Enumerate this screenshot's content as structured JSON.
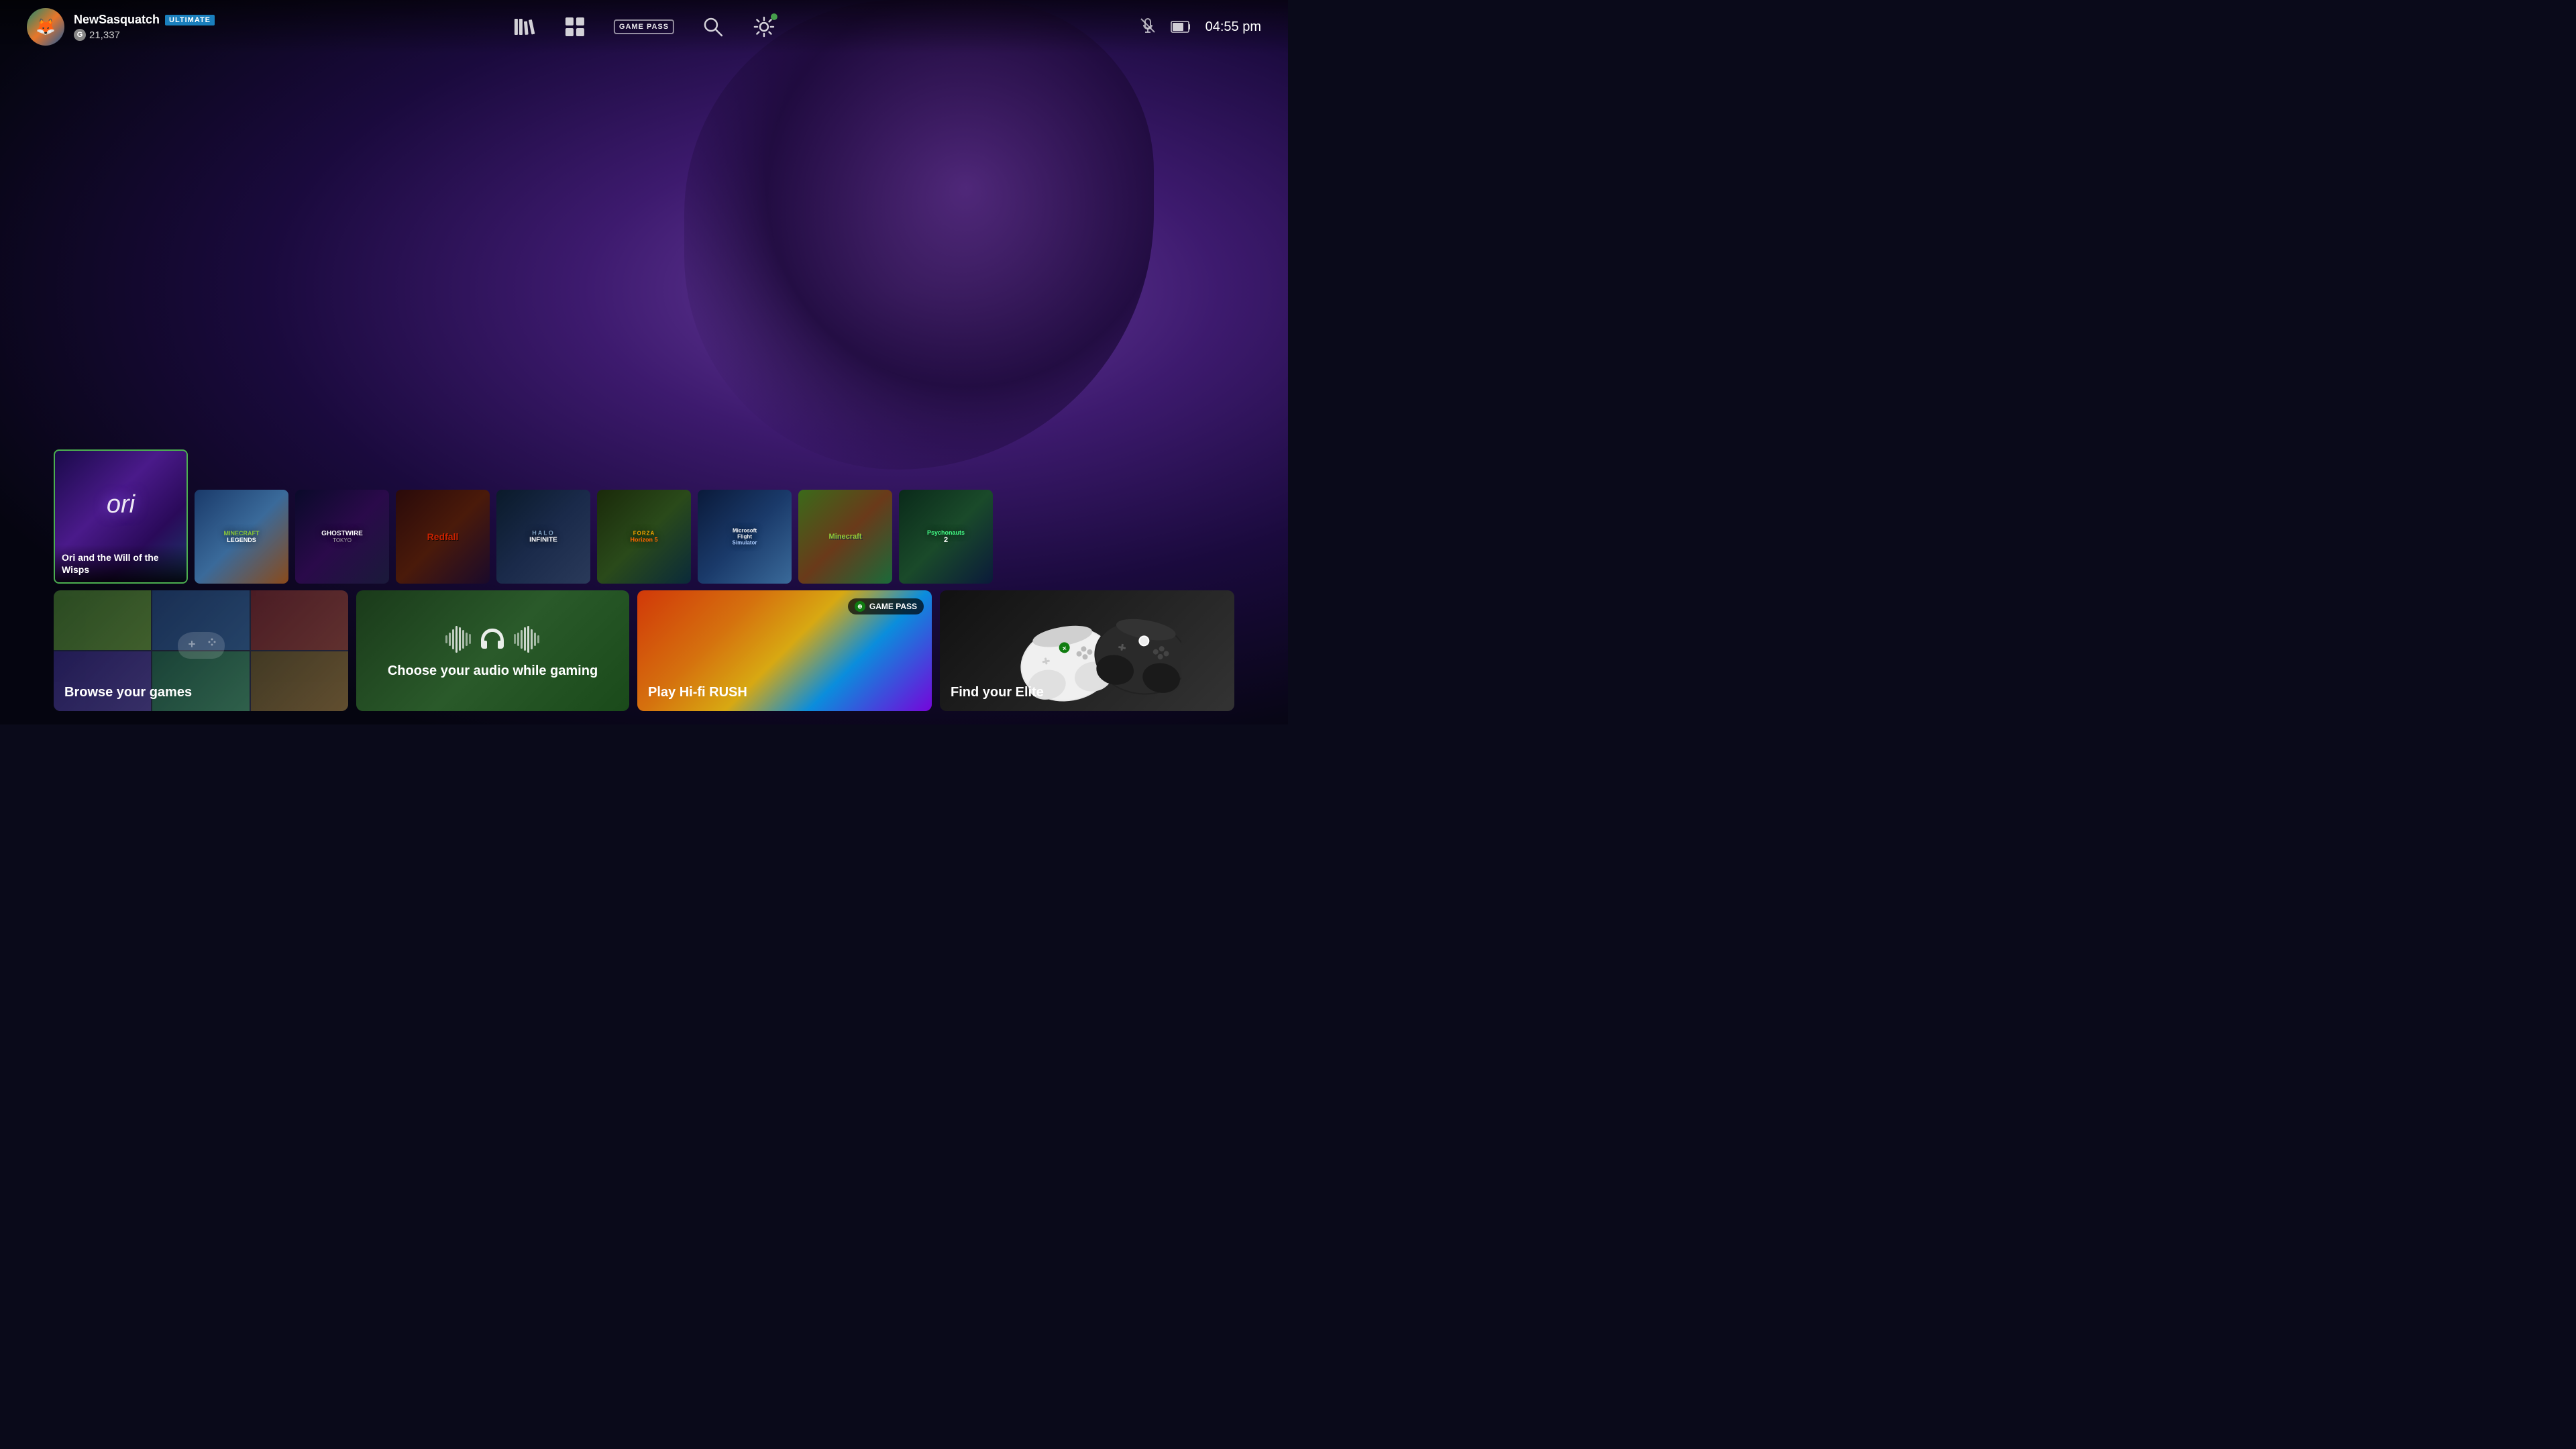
{
  "background": {
    "description": "Xbox dashboard with Ori and the Will of the Wisps wallpaper - dark purple forest with glowing bear"
  },
  "topbar": {
    "username": "NewSasquatch",
    "badge": "ULTIMATE",
    "gamerscore_label": "G",
    "gamerscore": "21,337",
    "nav": {
      "library_icon": "library",
      "grid_icon": "grid",
      "gamepass_label": "GAME PASS",
      "search_icon": "search",
      "settings_icon": "settings"
    },
    "status": {
      "mic_icon": "mic-slash",
      "battery_icon": "battery",
      "time": "04:55 pm"
    }
  },
  "games_row": [
    {
      "id": "ori",
      "title": "Ori and the Will of the Wisps",
      "featured": true,
      "art_class": "art-ori"
    },
    {
      "id": "minecraft-legends",
      "title": "Minecraft Legends",
      "featured": false,
      "art_class": "art-minecraft-legends"
    },
    {
      "id": "ghostwire",
      "title": "Ghostwire: Tokyo",
      "featured": false,
      "art_class": "art-ghostwire"
    },
    {
      "id": "redfall",
      "title": "Redfall",
      "featured": false,
      "art_class": "art-redfall"
    },
    {
      "id": "halo",
      "title": "Halo Infinite",
      "featured": false,
      "art_class": "art-halo"
    },
    {
      "id": "forza",
      "title": "Forza Horizon 5",
      "featured": false,
      "art_class": "art-forza"
    },
    {
      "id": "flight",
      "title": "Microsoft Flight Simulator",
      "featured": false,
      "art_class": "art-flight"
    },
    {
      "id": "minecraft",
      "title": "Minecraft",
      "featured": false,
      "art_class": "art-minecraft"
    },
    {
      "id": "psychonauts",
      "title": "Psychonauts 2",
      "featured": false,
      "art_class": "art-psychonauts"
    }
  ],
  "bottom_tiles": {
    "browse": {
      "label": "Browse your games"
    },
    "audio": {
      "label": "Choose your audio while gaming"
    },
    "gamepass_game": {
      "badge": "GAME PASS",
      "label": "Play Hi-fi RUSH"
    },
    "elite": {
      "label": "Find your Elite"
    }
  },
  "colors": {
    "accent_green": "#4caf50",
    "xbox_green": "#107c10",
    "ultimate_blue": "#1a7fbd",
    "gamepass_badge_bg": "rgba(0,0,0,0.7)"
  }
}
